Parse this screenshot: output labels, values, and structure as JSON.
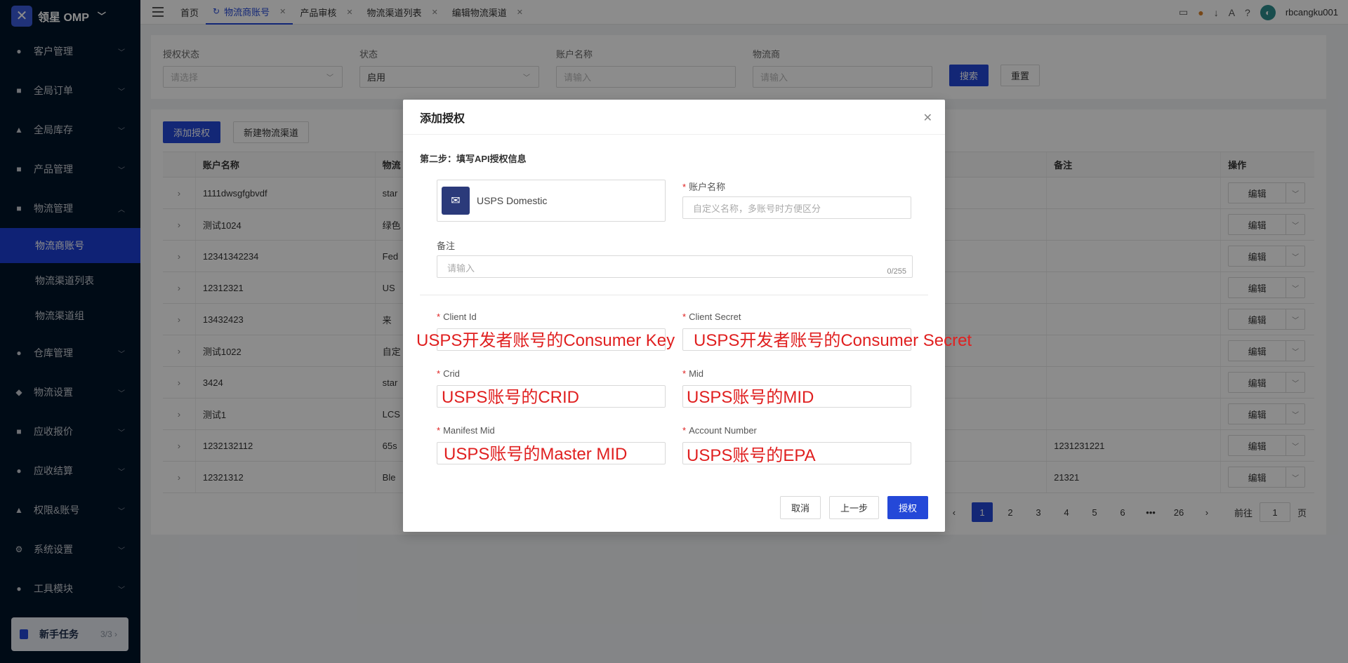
{
  "brand": {
    "title": "领星 OMP"
  },
  "sidebar": {
    "items": [
      {
        "label": "客户管理",
        "icon": "user-icon"
      },
      {
        "label": "全局订单",
        "icon": "order-icon"
      },
      {
        "label": "全局库存",
        "icon": "warehouse-icon"
      },
      {
        "label": "产品管理",
        "icon": "box-icon"
      },
      {
        "label": "物流管理",
        "icon": "truck-icon"
      }
    ],
    "sub_items": [
      {
        "label": "物流商账号"
      },
      {
        "label": "物流渠道列表"
      },
      {
        "label": "物流渠道组"
      }
    ],
    "items2": [
      {
        "label": "仓库管理",
        "icon": "building-icon"
      },
      {
        "label": "物流设置",
        "icon": "settings-icon"
      },
      {
        "label": "应收报价",
        "icon": "quote-icon"
      },
      {
        "label": "应收结算",
        "icon": "dollar-icon"
      },
      {
        "label": "权限&账号",
        "icon": "org-icon"
      },
      {
        "label": "系统设置",
        "icon": "gear-icon"
      },
      {
        "label": "工具模块",
        "icon": "tool-icon"
      }
    ],
    "newbie": {
      "label": "新手任务",
      "count": "3/3"
    }
  },
  "tabs": [
    {
      "label": "首页"
    },
    {
      "label": "物流商账号"
    },
    {
      "label": "产品审核"
    },
    {
      "label": "物流渠道列表"
    },
    {
      "label": "编辑物流渠道"
    }
  ],
  "user": {
    "name": "rbcangku001"
  },
  "filters": {
    "auth_status": {
      "label": "授权状态",
      "placeholder": "请选择"
    },
    "status": {
      "label": "状态",
      "value": "启用"
    },
    "account_name": {
      "label": "账户名称",
      "placeholder": "请输入"
    },
    "carrier": {
      "label": "物流商",
      "placeholder": "请输入"
    },
    "search_label": "搜索",
    "reset_label": "重置"
  },
  "actions": {
    "add_auth": "添加授权",
    "new_channel": "新建物流渠道"
  },
  "table": {
    "headers": {
      "name": "账户名称",
      "carrier": "物流",
      "note": "备注",
      "op": "操作"
    },
    "rows": [
      {
        "name": "1111dwsgfgbvdf",
        "carrier": "star",
        "note": ""
      },
      {
        "name": "测试1024",
        "carrier": "绿色",
        "note": ""
      },
      {
        "name": "12341342234",
        "carrier": "Fed",
        "note": ""
      },
      {
        "name": "12312321",
        "carrier": "US",
        "note": ""
      },
      {
        "name": "13432423",
        "carrier": "来",
        "note": ""
      },
      {
        "name": "测试1022",
        "carrier": "自定",
        "note": ""
      },
      {
        "name": "3424",
        "carrier": "star",
        "note": ""
      },
      {
        "name": "测试1",
        "carrier": "LCS",
        "note": ""
      },
      {
        "name": "1232132112",
        "carrier": "65s",
        "note": "1231231221"
      },
      {
        "name": "12321312",
        "carrier": "Ble",
        "note": "21321"
      }
    ],
    "edit_label": "编辑"
  },
  "pager": {
    "pages": [
      "1",
      "2",
      "3",
      "4",
      "5",
      "6",
      "•••",
      "26"
    ],
    "goto_prefix": "前往",
    "goto_value": "1",
    "goto_suffix": "页"
  },
  "modal": {
    "title": "添加授权",
    "step": "第二步：填写API授权信息",
    "carrier_name": "USPS Domestic",
    "account_name": {
      "label": "账户名称",
      "placeholder": "自定义名称，多账号时方便区分"
    },
    "note": {
      "label": "备注",
      "placeholder": "请输入",
      "counter": "0/255"
    },
    "client_id": {
      "label": "Client Id"
    },
    "client_secret": {
      "label": "Client Secret"
    },
    "crid": {
      "label": "Crid"
    },
    "mid": {
      "label": "Mid"
    },
    "manifest_mid": {
      "label": "Manifest Mid"
    },
    "account_number": {
      "label": "Account Number"
    },
    "cancel_label": "取消",
    "prev_label": "上一步",
    "submit_label": "授权"
  },
  "annotations": {
    "client_id": "USPS开发者账号的Consumer Key",
    "client_secret": "USPS开发者账号的Consumer Secret",
    "crid": "USPS账号的CRID",
    "mid": "USPS账号的MID",
    "manifest_mid": "USPS账号的Master MID",
    "account_number": "USPS账号的EPA"
  },
  "colors": {
    "primary": "#2448d8",
    "sidebar": "#001529",
    "annotation": "#e02020"
  }
}
